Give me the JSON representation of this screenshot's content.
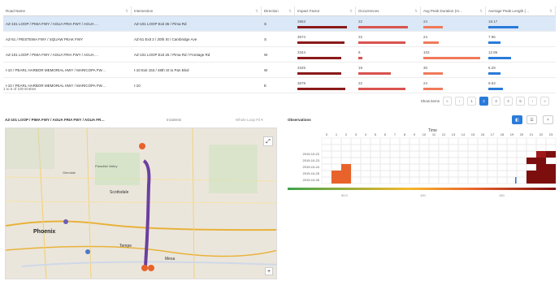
{
  "table": {
    "columns": [
      "Road Name",
      "Intersection",
      "Direction",
      "Impact Factor",
      "Occurrences",
      "Avg Peak Duration (m…",
      "Average Peak Length (…"
    ],
    "rows": [
      {
        "name": "AZ-101 LOOP / PIMA FWY / AGUA FRIA FWY / AGUA …",
        "intersection": "AZ-101 LOOP Exit 36 / Pima Rd",
        "direction": "S",
        "impact": "3863",
        "occ": "22",
        "dur": "24",
        "len": "18.17",
        "impact_frac": 0.91,
        "occ_frac": 0.85,
        "dur_frac": 0.33,
        "len_frac": 0.48,
        "selected": true
      },
      {
        "name": "AZ-51 / PIESTEWA FWY / SQUAW PEAK FWY",
        "intersection": "AZ-51 Exit 2 / 20th St / Cambridge Ave",
        "direction": "S",
        "impact": "3574",
        "occ": "22",
        "dur": "24",
        "len": "7.96",
        "impact_frac": 0.86,
        "occ_frac": 0.8,
        "dur_frac": 0.27,
        "len_frac": 0.19,
        "selected": false
      },
      {
        "name": "AZ-101 LOOP / PIMA FWY / AGUA FRIA FWY / AGUA …",
        "intersection": "AZ-101 LOOP Exit 26 / Pima Rd / Frontage Rd",
        "direction": "W",
        "impact": "3344",
        "occ": "6",
        "dur": "103",
        "len": "12.86",
        "impact_frac": 0.8,
        "occ_frac": 0.07,
        "dur_frac": 0.97,
        "len_frac": 0.36,
        "selected": false
      },
      {
        "name": "I-10 / PEARL HARBOR MEMORIAL HWY / MARICOPA FW…",
        "intersection": "I-10 Exit 153 / 48th St to Pan Blvd",
        "direction": "W",
        "impact": "3345",
        "occ": "19",
        "dur": "30",
        "len": "8.29",
        "impact_frac": 0.8,
        "occ_frac": 0.55,
        "dur_frac": 0.33,
        "len_frac": 0.2,
        "selected": false
      },
      {
        "name": "I-10 / PEARL HARBOR MEMORIAL HWY / MARICOPA FW…",
        "intersection": "I-10",
        "direction": "E",
        "impact": "3679",
        "occ": "22",
        "dur": "24",
        "len": "9.63",
        "impact_frac": 0.88,
        "occ_frac": 0.8,
        "dur_frac": 0.33,
        "len_frac": 0.23,
        "selected": false
      }
    ],
    "footer": "1 to 5 of 100 Entries"
  },
  "pager": {
    "label": "Show items",
    "pages": [
      "1",
      "2",
      "3",
      "4",
      "5"
    ],
    "active": "2",
    "prev": "‹",
    "next": "›",
    "first": "«",
    "last": "»"
  },
  "map_panel": {
    "title": "AZ-101 LOOP / PIMA FWY / AGUA FRIA FWY / AGUA FR…",
    "select": "Incidents",
    "select2": "Whole Loop Fil ▾",
    "cities": [
      "Phoenix",
      "Scottsdale",
      "Tempe",
      "Mesa",
      "Paradise Valley",
      "Glendale"
    ],
    "zoom": "+",
    "zoom_out": "−"
  },
  "observations": {
    "title": "Observations",
    "time_label": "Time",
    "hours": [
      "0",
      "1",
      "2",
      "3",
      "4",
      "5",
      "6",
      "7",
      "8",
      "9",
      "10",
      "11",
      "12",
      "13",
      "14",
      "15",
      "16",
      "17",
      "18",
      "19",
      "20",
      "21",
      "22",
      "23"
    ],
    "dates": [
      "2019-10-22",
      "2019-10-23",
      "2019-10-24",
      "2019-10-25",
      "2019-10-26"
    ],
    "legend_ticks": [
      "50.0",
      "100",
      "150"
    ],
    "cells": [
      {
        "d": 4,
        "h": 1,
        "v": 0.4
      },
      {
        "d": 3,
        "h": 1,
        "v": 0.4
      },
      {
        "d": 4,
        "h": 2,
        "v": 0.4
      },
      {
        "d": 3,
        "h": 2,
        "v": 0.5
      },
      {
        "d": 2,
        "h": 2,
        "v": 0.45
      },
      {
        "d": 0,
        "h": 22,
        "v": 0.9
      },
      {
        "d": 0,
        "h": 23,
        "v": 1
      },
      {
        "d": 1,
        "h": 21,
        "v": 1
      },
      {
        "d": 1,
        "h": 22,
        "v": 1
      },
      {
        "d": 2,
        "h": 22,
        "v": 1
      },
      {
        "d": 2,
        "h": 23,
        "v": 1
      },
      {
        "d": 3,
        "h": 21,
        "v": 0.95
      },
      {
        "d": 3,
        "h": 22,
        "v": 1
      },
      {
        "d": 3,
        "h": 23,
        "v": 1
      },
      {
        "d": 4,
        "h": 21,
        "v": 1
      },
      {
        "d": 4,
        "h": 22,
        "v": 1
      },
      {
        "d": 4,
        "h": 23,
        "v": 1
      },
      {
        "d": 4,
        "h": 19,
        "v": 0.1
      }
    ]
  },
  "colors": {
    "impact": "#8b1a1a",
    "occ": "#d9534f",
    "dur": "#f07a5a",
    "len": "#2a7bd9",
    "accent": "#2a7bd9"
  }
}
